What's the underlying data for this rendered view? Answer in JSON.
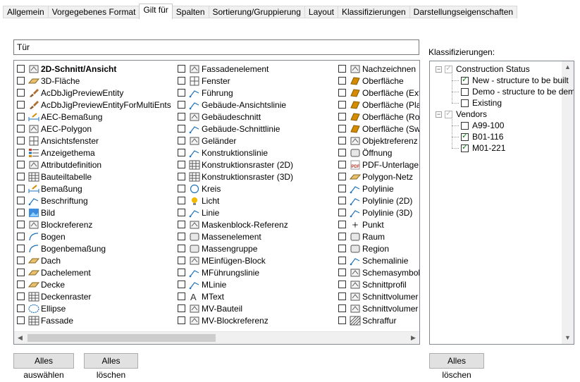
{
  "tabs": [
    {
      "label": "Allgemein",
      "active": false
    },
    {
      "label": "Vorgegebenes Format",
      "active": false
    },
    {
      "label": "Gilt für",
      "active": true
    },
    {
      "label": "Spalten",
      "active": false
    },
    {
      "label": "Sortierung/Gruppierung",
      "active": false
    },
    {
      "label": "Layout",
      "active": false
    },
    {
      "label": "Klassifizierungen",
      "active": false
    },
    {
      "label": "Darstellungseigenschaften",
      "active": false
    }
  ],
  "filter": {
    "value": "Tür"
  },
  "object_types": {
    "column1": [
      {
        "label": "2D-Schnitt/Ansicht",
        "icon": "2d-section-icon",
        "bold": true
      },
      {
        "label": "3D-Fläche",
        "icon": "3d-face-icon"
      },
      {
        "label": "AcDbJigPreviewEntity",
        "icon": "brush-icon"
      },
      {
        "label": "AcDbJigPreviewEntityForMultiEnts",
        "icon": "brush-icon"
      },
      {
        "label": "AEC-Bemaßung",
        "icon": "aec-dimension-icon"
      },
      {
        "label": "AEC-Polygon",
        "icon": "polygon-icon"
      },
      {
        "label": "Ansichtsfenster",
        "icon": "viewport-icon"
      },
      {
        "label": "Anzeigethema",
        "icon": "display-theme-icon"
      },
      {
        "label": "Attributdefinition",
        "icon": "attribute-tag-icon"
      },
      {
        "label": "Bauteiltabelle",
        "icon": "table-icon"
      },
      {
        "label": "Bemaßung",
        "icon": "dimension-icon"
      },
      {
        "label": "Beschriftung",
        "icon": "leader-icon"
      },
      {
        "label": "Bild",
        "icon": "image-icon"
      },
      {
        "label": "Blockreferenz",
        "icon": "block-reference-icon"
      },
      {
        "label": "Bogen",
        "icon": "arc-icon"
      },
      {
        "label": "Bogenbemaßung",
        "icon": "arc-dimension-icon"
      },
      {
        "label": "Dach",
        "icon": "roof-icon"
      },
      {
        "label": "Dachelement",
        "icon": "roof-slab-icon"
      },
      {
        "label": "Decke",
        "icon": "slab-icon"
      },
      {
        "label": "Deckenraster",
        "icon": "ceiling-grid-icon"
      },
      {
        "label": "Ellipse",
        "icon": "ellipse-icon"
      },
      {
        "label": "Fassade",
        "icon": "facade-icon"
      }
    ],
    "column2": [
      {
        "label": "Fassadenelement",
        "icon": "curtain-wall-unit-icon"
      },
      {
        "label": "Fenster",
        "icon": "window-icon"
      },
      {
        "label": "Führung",
        "icon": "leader-arrow-icon"
      },
      {
        "label": "Gebäude-Ansichtslinie",
        "icon": "elevation-line-icon"
      },
      {
        "label": "Gebäudeschnitt",
        "icon": "building-section-icon"
      },
      {
        "label": "Gebäude-Schnittlinie",
        "icon": "section-line-icon"
      },
      {
        "label": "Geländer",
        "icon": "railing-icon"
      },
      {
        "label": "Konstruktionslinie",
        "icon": "construction-line-icon"
      },
      {
        "label": "Konstruktionsraster (2D)",
        "icon": "grid-2d-icon"
      },
      {
        "label": "Konstruktionsraster (3D)",
        "icon": "grid-3d-icon"
      },
      {
        "label": "Kreis",
        "icon": "circle-icon"
      },
      {
        "label": "Licht",
        "icon": "light-bulb-icon"
      },
      {
        "label": "Linie",
        "icon": "line-icon"
      },
      {
        "label": "Maskenblock-Referenz",
        "icon": "mask-block-icon"
      },
      {
        "label": "Massenelement",
        "icon": "mass-element-icon"
      },
      {
        "label": "Massengruppe",
        "icon": "mass-group-icon"
      },
      {
        "label": "MEinfügen-Block",
        "icon": "minsert-block-icon"
      },
      {
        "label": "MFührungslinie",
        "icon": "multileader-icon"
      },
      {
        "label": "MLinie",
        "icon": "mline-icon"
      },
      {
        "label": "MText",
        "icon": "mtext-icon"
      },
      {
        "label": "MV-Bauteil",
        "icon": "mv-part-icon"
      },
      {
        "label": "MV-Blockreferenz",
        "icon": "mv-block-icon"
      }
    ],
    "column3": [
      {
        "label": "Nachzeichnen",
        "icon": "trace-icon"
      },
      {
        "label": "Oberfläche",
        "icon": "surface-icon"
      },
      {
        "label": "Oberfläche (Ext",
        "icon": "surface-extruded-icon"
      },
      {
        "label": "Oberfläche (Pla",
        "icon": "surface-planar-icon"
      },
      {
        "label": "Oberfläche (Rot",
        "icon": "surface-revolved-icon"
      },
      {
        "label": "Oberfläche (Sw",
        "icon": "surface-swept-icon"
      },
      {
        "label": "Objektreferenz",
        "icon": "object-reference-icon"
      },
      {
        "label": "Öffnung",
        "icon": "opening-icon"
      },
      {
        "label": "PDF-Unterlage",
        "icon": "pdf-icon"
      },
      {
        "label": "Polygon-Netz",
        "icon": "polygon-mesh-icon"
      },
      {
        "label": "Polylinie",
        "icon": "polyline-icon"
      },
      {
        "label": "Polylinie (2D)",
        "icon": "polyline-2d-icon"
      },
      {
        "label": "Polylinie (3D)",
        "icon": "polyline-3d-icon"
      },
      {
        "label": "Punkt",
        "icon": "point-icon"
      },
      {
        "label": "Raum",
        "icon": "space-icon"
      },
      {
        "label": "Region",
        "icon": "region-icon"
      },
      {
        "label": "Schemalinie",
        "icon": "schematic-line-icon"
      },
      {
        "label": "Schemasymbol",
        "icon": "schematic-symbol-icon"
      },
      {
        "label": "Schnittprofil",
        "icon": "section-profile-icon"
      },
      {
        "label": "Schnittvolumer",
        "icon": "section-volume-icon"
      },
      {
        "label": "Schnittvolumer",
        "icon": "section-volume-icon"
      },
      {
        "label": "Schraffur",
        "icon": "hatch-icon"
      }
    ]
  },
  "buttons": {
    "select_all": "Alles auswählen",
    "clear_all": "Alles löschen",
    "clear_all_classifications": "Alles löschen"
  },
  "classifications": {
    "label": "Klassifizierungen:",
    "groups": [
      {
        "name": "Construction Status",
        "expanded": true,
        "checked": "grey",
        "items": [
          {
            "name": "New - structure to be built",
            "checked": true
          },
          {
            "name": "Demo - structure to be demolis",
            "checked": false
          },
          {
            "name": "Existing",
            "checked": false
          }
        ]
      },
      {
        "name": "Vendors",
        "expanded": true,
        "checked": "grey",
        "items": [
          {
            "name": "A99-100",
            "checked": false
          },
          {
            "name": "B01-116",
            "checked": true
          },
          {
            "name": "M01-221",
            "checked": true
          }
        ]
      }
    ]
  },
  "colors": {
    "check": "#107c10",
    "border": "#828790",
    "button_bg": "#e1e1e1"
  }
}
